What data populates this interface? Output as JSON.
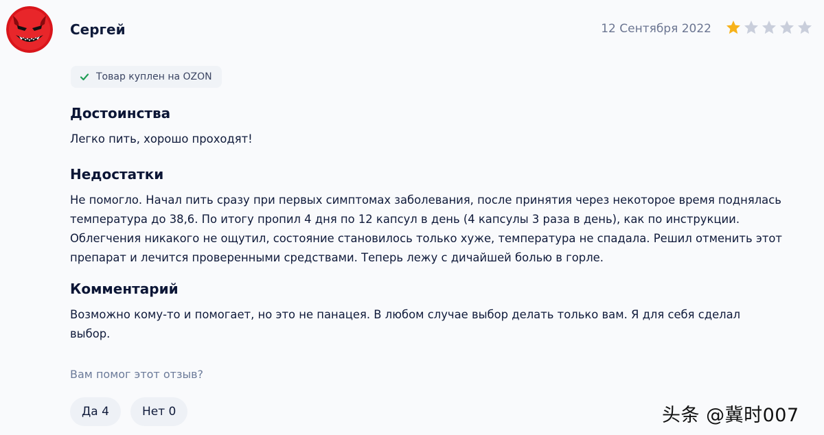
{
  "review": {
    "author": "Сергей",
    "date": "12 Сентября 2022",
    "rating": 1,
    "rating_max": 5,
    "star_filled_color": "#f7b21a",
    "star_empty_color": "#c9cedb",
    "avatar_icon": "red-devil-face-icon",
    "badge": {
      "icon": "check-icon",
      "text": "Товар куплен на OZON"
    },
    "pros": {
      "title": "Достоинства",
      "text": "Легко пить, хорошо проходят!"
    },
    "cons": {
      "title": "Недостатки",
      "text": "Не помогло. Начал пить сразу при первых симптомах заболевания, после принятия через некоторое время поднялась\nтемпература до 38,6. По итогу пропил 4 дня по 12 капсул в день (4 капсулы 3 раза в день), как по инструкции.\nОблегчения никакого не ощутил, состояние становилось только хуже, температура не спадала. Решил отменить этот\nпрепарат и лечится проверенными средствами. Теперь лежу с дичайшей болью в горле."
    },
    "comment": {
      "title": "Комментарий",
      "text": "Возможно кому-то и помогает, но это не панацея. В любом случае выбор делать только вам. Я для себя сделал\nвыбор."
    },
    "helpful": {
      "question": "Вам помог этот отзыв?",
      "yes_label": "Да 4",
      "no_label": "Нет 0"
    }
  },
  "watermark": "头条 @冀时007"
}
